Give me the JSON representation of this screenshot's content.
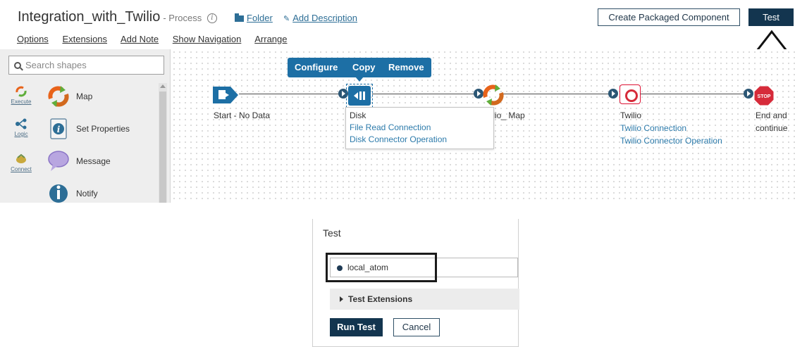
{
  "header": {
    "title": "Integration_with_Twilio",
    "type_label": "- Process",
    "info_glyph": "i",
    "folder_label": "Folder",
    "add_description_label": "Add Description",
    "create_packaged_label": "Create Packaged Component",
    "test_label": "Test"
  },
  "menu": {
    "items": [
      "Options",
      "Extensions",
      "Add Note",
      "Show Navigation",
      "Arrange"
    ]
  },
  "palette": {
    "search_placeholder": "Search shapes",
    "categories": [
      "Execute",
      "Logic",
      "Connect"
    ],
    "shapes": [
      "Map",
      "Set Properties",
      "Message",
      "Notify"
    ]
  },
  "canvas": {
    "popover": {
      "configure": "Configure",
      "copy": "Copy",
      "remove": "Remove"
    },
    "start": {
      "label": "Start - No Data"
    },
    "disk": {
      "label": "Disk",
      "connection": "File Read Connection",
      "operation": "Disk Connector Operation"
    },
    "map": {
      "label": "lilio_ Map"
    },
    "twilio": {
      "label": "Twilio",
      "connection": "Twilio Connection",
      "operation": "Twilio Connector Operation"
    },
    "end": {
      "label_line1": "End and",
      "label_line2": "continue",
      "badge": "STOP"
    }
  },
  "test_dialog": {
    "title": "Test",
    "atom": "local_atom",
    "extensions_label": "Test Extensions",
    "run_label": "Run Test",
    "cancel_label": "Cancel"
  },
  "colors": {
    "primary_dark": "#13354f",
    "accent_blue": "#1d6fa5",
    "link_blue": "#2d7bab",
    "stop_red": "#d62b3a",
    "map_orange": "#e8631a",
    "map_green": "#5fae3b"
  }
}
